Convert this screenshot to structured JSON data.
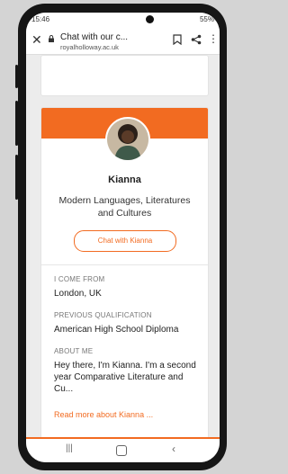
{
  "status": {
    "time": "15:46",
    "battery": "55%"
  },
  "browser": {
    "title": "Chat with our c...",
    "domain": "royalholloway.ac.uk"
  },
  "profile": {
    "name": "Kianna",
    "subject": "Modern Languages, Literatures and Cultures",
    "chat_button": "Chat with Kianna",
    "from_label": "I COME FROM",
    "from_value": "London, UK",
    "qual_label": "PREVIOUS QUALIFICATION",
    "qual_value": "American High School Diploma",
    "about_label": "ABOUT ME",
    "about_value": "Hey there, I'm Kianna. I'm a second year Comparative Literature and Cu...",
    "read_more": "Read more about Kianna ..."
  },
  "colors": {
    "accent": "#f26b21"
  },
  "icons": {
    "close": "close-icon",
    "lock": "lock-icon",
    "bookmark": "bookmark-icon",
    "share": "share-icon",
    "more": "more-vertical-icon",
    "recents": "recents-icon",
    "home": "home-icon",
    "back": "back-icon"
  }
}
